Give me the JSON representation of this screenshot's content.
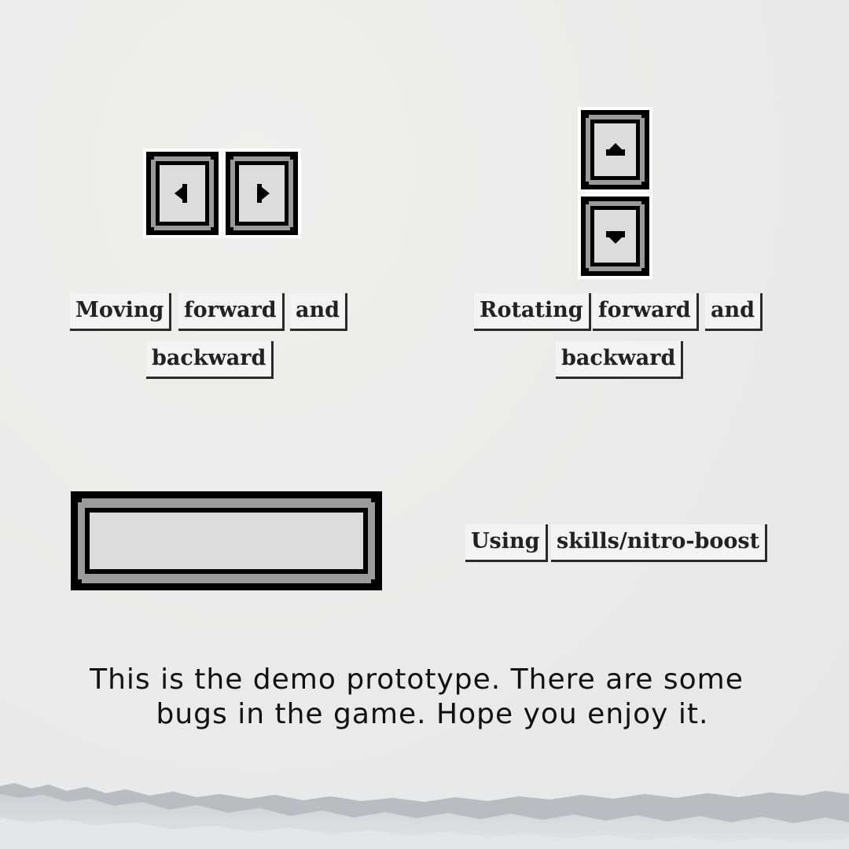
{
  "controls": {
    "move": {
      "keys": [
        {
          "name": "left-arrow-key",
          "icon": "arrow-left-icon"
        },
        {
          "name": "right-arrow-key",
          "icon": "arrow-right-icon"
        }
      ],
      "words": [
        "Moving",
        "forward",
        "and",
        "backward"
      ]
    },
    "rotate": {
      "keys": [
        {
          "name": "up-arrow-key",
          "icon": "arrow-up-icon"
        },
        {
          "name": "down-arrow-key",
          "icon": "arrow-down-icon"
        }
      ],
      "words": [
        "Rotating",
        "forward",
        "and",
        "backward"
      ]
    },
    "skill": {
      "key": {
        "name": "space-bar-key"
      },
      "words": [
        "Using",
        "skills/nitro-boost"
      ]
    }
  },
  "note": {
    "line1": "This is the demo prototype. There are some",
    "line2": "bugs in the game. Hope you enjoy it."
  },
  "colors": {
    "paper": "#eaeaea",
    "key_face": "#dcdcdc",
    "key_bevel": "#9a9a9a",
    "outline": "#000000"
  }
}
